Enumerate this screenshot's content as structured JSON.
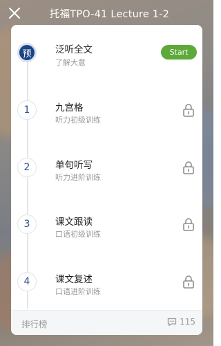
{
  "header": {
    "title": "托福TPO-41 Lecture 1-2",
    "close_icon": "close-icon"
  },
  "steps": [
    {
      "badge": "预",
      "title": "泛听全文",
      "subtitle": "了解大意",
      "action": "Start",
      "locked": false
    },
    {
      "badge": "1",
      "title": "九宫格",
      "subtitle": "听力初级训练",
      "locked": true
    },
    {
      "badge": "2",
      "title": "单句听写",
      "subtitle": "听力进阶训练",
      "locked": true
    },
    {
      "badge": "3",
      "title": "课文跟读",
      "subtitle": "口语初级训练",
      "locked": true
    },
    {
      "badge": "4",
      "title": "课文复述",
      "subtitle": "口语进阶训练",
      "locked": true
    }
  ],
  "footer": {
    "leaderboard_label": "排行榜",
    "comment_count": "115",
    "comment_icon": "comment-icon"
  },
  "colors": {
    "accent_blue": "#1d4586",
    "start_green": "#5da93a",
    "muted_text": "#9a9a9a"
  }
}
